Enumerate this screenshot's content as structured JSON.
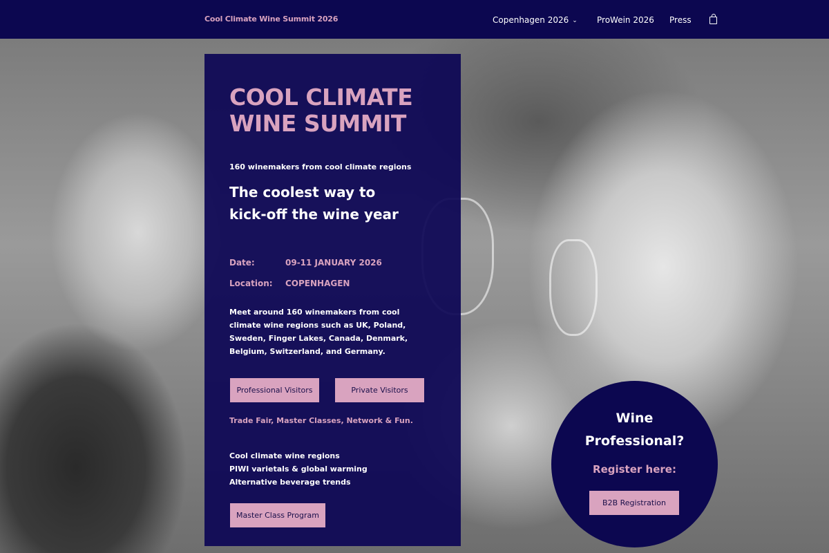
{
  "header": {
    "brand": "Cool Climate Wine Summit 2026",
    "nav": [
      {
        "label": "Copenhagen 2026",
        "has_dropdown": true
      },
      {
        "label": "ProWein 2026"
      },
      {
        "label": "Press"
      }
    ],
    "cart_icon": "shopping-bag-icon"
  },
  "hero": {
    "title_line1": "COOL CLIMATE",
    "title_line2": "WINE SUMMIT",
    "subtitle": "160 winemakers from cool climate regions",
    "tagline_line1": "The coolest way to",
    "tagline_line2": "kick-off the wine year",
    "date_label": "Date:",
    "date_value": "09-11 JANUARY 2026",
    "location_label": "Location:",
    "location_value": "COPENHAGEN",
    "description": "Meet around 160 winemakers from cool climate wine regions such as UK, Poland, Sweden, Finger Lakes, Canada, Denmark, Belgium, Switzerland, and Germany.",
    "buttons": {
      "professional": "Professional Visitors",
      "private": "Private Visitors"
    },
    "features": "Trade Fair, Master Classes, Network & Fun.",
    "topics": [
      "Cool climate wine regions",
      "PIWI varietals & global warming",
      "Alternative beverage trends"
    ],
    "master_class_button": "Master Class Program"
  },
  "cta": {
    "heading_line1": "Wine",
    "heading_line2": "Professional?",
    "subheading": "Register here:",
    "button": "B2B Registration"
  },
  "colors": {
    "navy": "#0c0750",
    "pink": "#d9a3bf",
    "white": "#ffffff"
  }
}
